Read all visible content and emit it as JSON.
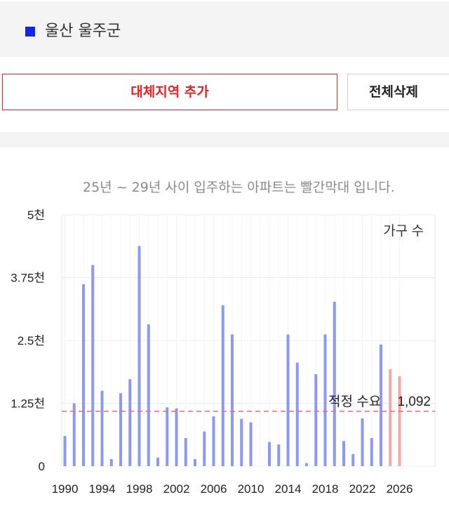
{
  "region": {
    "name": "울산 울주군",
    "marker_color": "#1c22e8"
  },
  "buttons": {
    "add_region": "대체지역 추가",
    "delete_all": "전체삭제"
  },
  "note": "25년 ~ 29년 사이 입주하는 아파트는 빨간막대 입니다.",
  "chart_data": {
    "type": "bar",
    "legend": "가구 수",
    "x": [
      1990,
      1991,
      1992,
      1993,
      1994,
      1995,
      1996,
      1997,
      1998,
      1999,
      2000,
      2001,
      2002,
      2003,
      2004,
      2005,
      2006,
      2007,
      2008,
      2009,
      2010,
      2011,
      2012,
      2013,
      2014,
      2015,
      2016,
      2017,
      2018,
      2019,
      2020,
      2021,
      2022,
      2023,
      2024,
      2025,
      2026
    ],
    "values": [
      600,
      1250,
      3620,
      4000,
      1500,
      140,
      1450,
      1730,
      4380,
      2820,
      170,
      1170,
      1150,
      560,
      140,
      690,
      990,
      3200,
      2620,
      940,
      870,
      0,
      480,
      430,
      2620,
      2060,
      60,
      1830,
      2620,
      3270,
      500,
      240,
      950,
      560,
      2420,
      1930,
      1790
    ],
    "highlight_from": 2025,
    "colors": {
      "bar": "#8c98f2",
      "highlight": "#f4a8a3",
      "ref_line": "#f26b6b"
    },
    "y_ticks": [
      {
        "v": 0,
        "label": "0"
      },
      {
        "v": 1250,
        "label": "1.25천"
      },
      {
        "v": 2500,
        "label": "2.5천"
      },
      {
        "v": 3750,
        "label": "3.75천"
      },
      {
        "v": 5000,
        "label": "5천"
      }
    ],
    "x_ticks": [
      1990,
      1994,
      1998,
      2002,
      2006,
      2010,
      2014,
      2018,
      2022,
      2026
    ],
    "ylim": [
      0,
      5000
    ],
    "grid": true,
    "reference": {
      "value": 1092,
      "label": "적정 수요",
      "value_label": "1,092"
    }
  }
}
